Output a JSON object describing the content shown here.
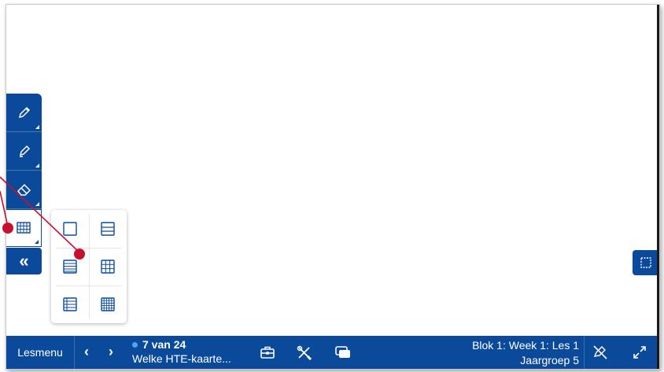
{
  "toolbar": {
    "tools": [
      "pencil-icon",
      "marker-icon",
      "eraser-icon",
      "grid-icon"
    ],
    "collapse_label": "«"
  },
  "grid_popup": {
    "options": [
      "blank",
      "lines-wide",
      "lines-narrow",
      "grid-large",
      "ledger",
      "grid-small"
    ]
  },
  "bottombar": {
    "menu_label": "Lesmenu",
    "prev_label": "‹",
    "next_label": "›",
    "page_count": "7 van 24",
    "page_title": "Welke HTE-kaarte...",
    "lesson": "Blok 1: Week 1: Les 1",
    "group": "Jaargroep 5"
  },
  "colors": {
    "brand": "#0b4a9b",
    "annotation": "#c8102e",
    "status_dot": "#4da3ff"
  }
}
